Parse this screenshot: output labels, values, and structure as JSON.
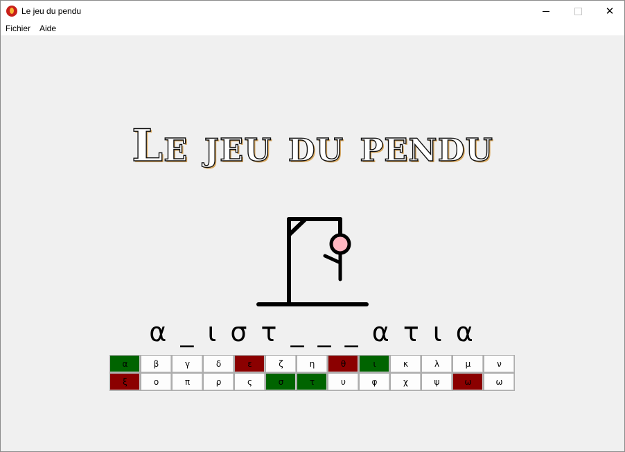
{
  "window": {
    "title": "Le jeu du pendu",
    "icon": "flame-icon"
  },
  "menu": {
    "file": "Fichier",
    "help": "Aide"
  },
  "game": {
    "heading": "Le jeu du pendu",
    "word": "α _ ι σ τ _ _ _ α τ ι α",
    "colors": {
      "correct": "#006400",
      "wrong": "#8b0000",
      "neutral": "#fdfdfd",
      "head": "#ffb6c1"
    }
  },
  "keyboard": {
    "row1": [
      {
        "letter": "α",
        "state": "correct"
      },
      {
        "letter": "β",
        "state": "neutral"
      },
      {
        "letter": "γ",
        "state": "neutral"
      },
      {
        "letter": "δ",
        "state": "neutral"
      },
      {
        "letter": "ε",
        "state": "wrong"
      },
      {
        "letter": "ζ",
        "state": "neutral"
      },
      {
        "letter": "η",
        "state": "neutral"
      },
      {
        "letter": "θ",
        "state": "wrong"
      },
      {
        "letter": "ι",
        "state": "correct"
      },
      {
        "letter": "κ",
        "state": "neutral"
      },
      {
        "letter": "λ",
        "state": "neutral"
      },
      {
        "letter": "μ",
        "state": "neutral"
      },
      {
        "letter": "ν",
        "state": "neutral"
      }
    ],
    "row2": [
      {
        "letter": "ξ",
        "state": "wrong"
      },
      {
        "letter": "ο",
        "state": "neutral"
      },
      {
        "letter": "π",
        "state": "neutral"
      },
      {
        "letter": "ρ",
        "state": "neutral"
      },
      {
        "letter": "ς",
        "state": "neutral"
      },
      {
        "letter": "σ",
        "state": "correct"
      },
      {
        "letter": "τ",
        "state": "correct"
      },
      {
        "letter": "υ",
        "state": "neutral"
      },
      {
        "letter": "φ",
        "state": "neutral"
      },
      {
        "letter": "χ",
        "state": "neutral"
      },
      {
        "letter": "ψ",
        "state": "neutral"
      },
      {
        "letter": "ω",
        "state": "wrong"
      },
      {
        "letter": "ω",
        "state": "neutral"
      }
    ]
  }
}
